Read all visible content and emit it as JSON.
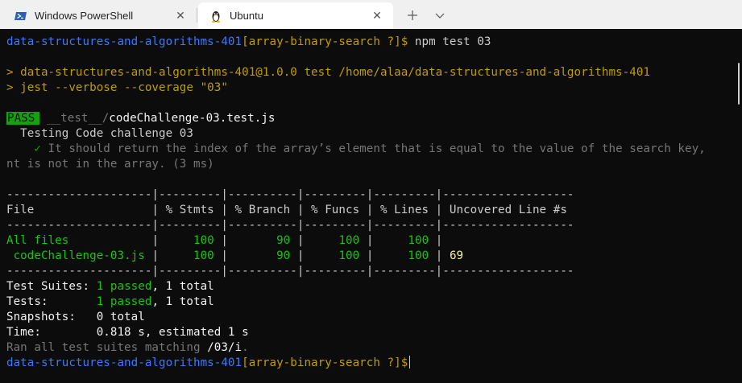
{
  "tabs": [
    {
      "label": "Windows PowerShell",
      "icon": "powershell-icon",
      "active": false
    },
    {
      "label": "Ubuntu",
      "icon": "linux-penguin-icon",
      "active": true
    }
  ],
  "tabbar": {
    "close_glyph": "✕",
    "new_tab_glyph": "+",
    "dropdown_glyph": "⌄"
  },
  "terminal": {
    "prompt_dir": "data-structures-and-algorithms-401",
    "prompt_branch": "[array-binary-search ?]$",
    "command": " npm test 03",
    "script_line1": "> data-structures-and-algorithms-401@1.0.0 test /home/alaa/data-structures-and-algorithms-401",
    "script_line2": "> jest --verbose --coverage \"03\"",
    "pass_label": "PASS",
    "test_dir": " __test__/",
    "test_file": "codeChallenge-03.test.js",
    "describe": "  Testing Code challenge 03",
    "check": "    ✓",
    "test_desc": " It should return the index of the array’s element that is equal to the value of the search key,",
    "test_desc_cont": "nt is not in the array. (3 ms)",
    "table_sep": "---------------------|---------|----------|---------|---------|-------------------",
    "table_header": "File                 | % Stmts | % Branch | % Funcs | % Lines | Uncovered Line #s ",
    "table_rows": [
      {
        "file": "All files            ",
        "stmts": "100",
        "branch": "90",
        "funcs": "100",
        "lines": "100",
        "uncovered": ""
      },
      {
        "file": " codeChallenge-03.js ",
        "stmts": "100",
        "branch": "90",
        "funcs": "100",
        "lines": "100",
        "uncovered": "69"
      }
    ],
    "suites_label": "Test Suites: ",
    "suites_passed": "1 passed",
    "suites_total": ", 1 total",
    "tests_label": "Tests:       ",
    "tests_passed": "1 passed",
    "tests_total": ", 1 total",
    "snapshots": "Snapshots:   0 total",
    "time": "Time:        0.818 s, estimated 1 s",
    "ran_prefix": "Ran all test suites matching ",
    "ran_pattern": "/03/i",
    "ran_suffix": "."
  },
  "colors": {
    "background": "#0c0c0c",
    "prompt_blue": "#3b78ff",
    "branch_yellow": "#c19c00",
    "pass_green": "#13a10e",
    "success_green": "#16c60c",
    "dim_gray": "#767676"
  }
}
